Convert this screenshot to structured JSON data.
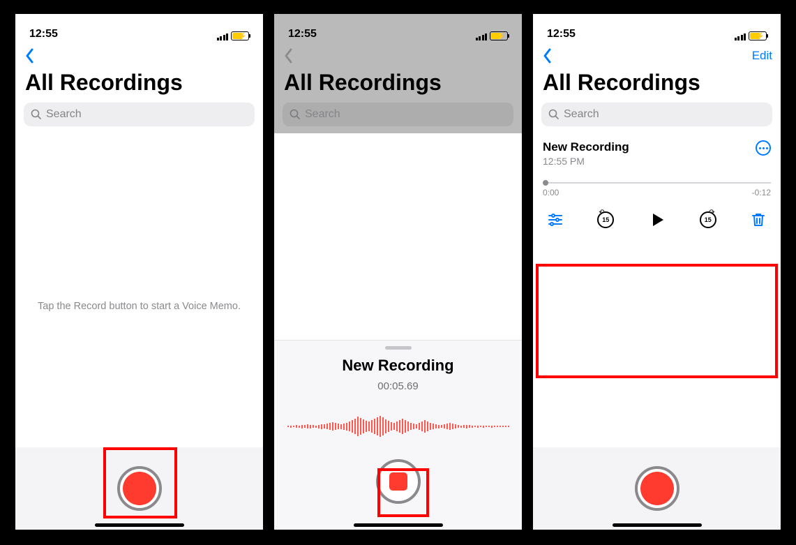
{
  "status": {
    "time": "12:55"
  },
  "common": {
    "title": "All Recordings",
    "search_placeholder": "Search"
  },
  "screen1": {
    "hint": "Tap the Record button to start a Voice Memo."
  },
  "screen2": {
    "rec_title": "New Recording",
    "rec_timer": "00:05.69"
  },
  "screen3": {
    "edit_label": "Edit",
    "item": {
      "name": "New Recording",
      "subtitle": "12:55 PM",
      "pos": "0:00",
      "remaining": "-0:12",
      "skip_label": "15"
    }
  }
}
